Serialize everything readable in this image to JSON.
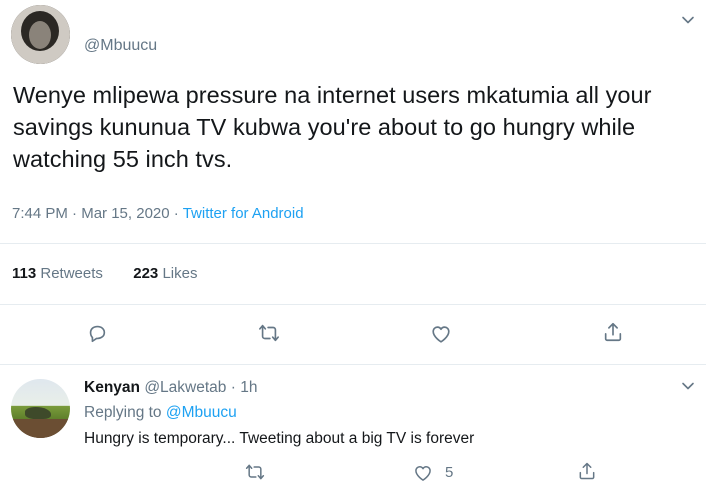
{
  "tweet": {
    "handle": "@Mbuucu",
    "text": "Wenye mlipewa pressure na internet users mkatumia all your savings kununua TV kubwa you're about to go hungry while watching 55 inch tvs.",
    "time": "7:44 PM",
    "sep1": "·",
    "date": "Mar 15, 2020",
    "sep2": "·",
    "source": "Twitter for Android",
    "retweet_count": "113",
    "retweet_label": "Retweets",
    "like_count": "223",
    "like_label": "Likes"
  },
  "reply": {
    "name": "Kenyan",
    "handle": "@Lakwetab",
    "sep": "·",
    "age": "1h",
    "replying_prefix": "Replying to",
    "replying_to": "@Mbuucu",
    "text": "Hungry is temporary... Tweeting about a big TV is forever",
    "like_count": "5"
  },
  "icons": {
    "reply": "reply-icon",
    "retweet": "retweet-icon",
    "like": "heart-icon",
    "share": "share-icon",
    "menu": "chevron-down-icon"
  },
  "colors": {
    "link": "#1da1f2",
    "secondary": "#657786",
    "primary": "#14171a",
    "divider": "#e6ecf0"
  }
}
